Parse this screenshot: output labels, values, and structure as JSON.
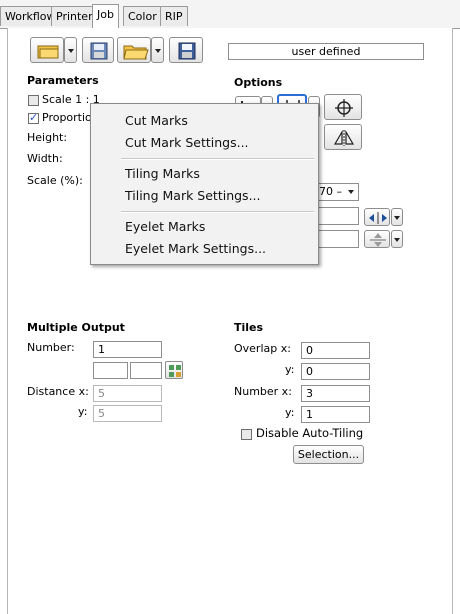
{
  "tabs": [
    "Workflow",
    "Printer",
    "Job",
    "Color",
    "RIP"
  ],
  "active_tab": "Job",
  "template": {
    "value": "user defined"
  },
  "parameters": {
    "heading": "Parameters",
    "scale_label": "Scale 1 : 1",
    "scale_checked": false,
    "proportional_label": "Proportio",
    "proportional_checked": true,
    "height_label": "Height:",
    "width_label": "Width:",
    "scale_pct_label": "Scale (%):"
  },
  "options": {
    "heading": "Options",
    "partial_select_value": "70 –"
  },
  "context_menu": {
    "items": [
      "Cut Marks",
      "Cut Mark Settings...",
      "Tiling Marks",
      "Tiling Mark Settings...",
      "Eyelet Marks",
      "Eyelet Mark Settings..."
    ]
  },
  "multiple_output": {
    "heading": "Multiple Output",
    "number_label": "Number:",
    "number_value": "1",
    "distance_x_label": "Distance x:",
    "distance_x_value": "5",
    "y_label": "y:",
    "y_value": "5"
  },
  "tiles": {
    "heading": "Tiles",
    "overlap_x_label": "Overlap x:",
    "overlap_x_value": "0",
    "overlap_y_label": "y:",
    "overlap_y_value": "0",
    "number_x_label": "Number x:",
    "number_x_value": "3",
    "number_y_label": "y:",
    "number_y_value": "1",
    "disable_auto_tiling_label": "Disable Auto-Tiling",
    "disable_auto_tiling_checked": false,
    "selection_button": "Selection..."
  },
  "colors": {
    "accent": "#2b6fd6",
    "menu_bg": "#f2f2f2"
  },
  "icons": [
    "open-icon",
    "save-as-icon",
    "folder-icon",
    "save-icon",
    "crop-icon",
    "cut-marks-icon",
    "crosshair-icon",
    "mirror-icon",
    "grid-icon",
    "arrows-horizontal-icon",
    "arrows-vertical-icon"
  ]
}
